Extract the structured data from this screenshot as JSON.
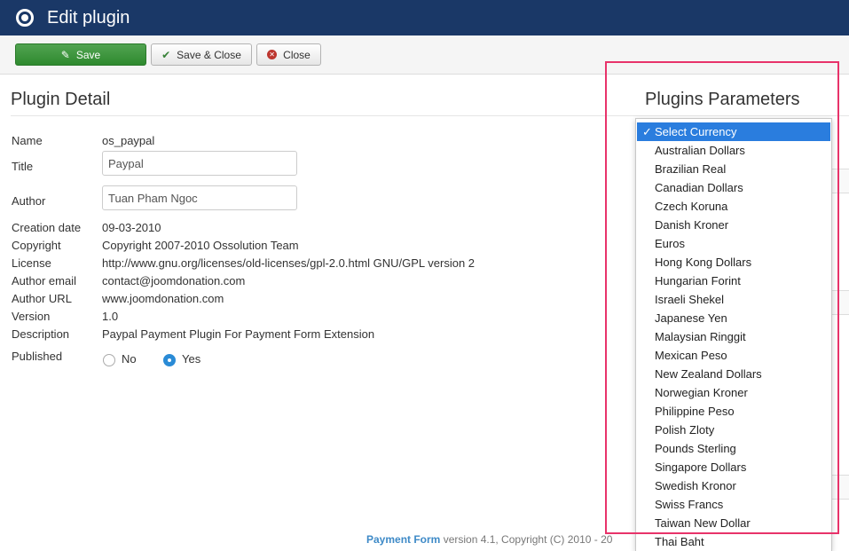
{
  "header": {
    "title": "Edit plugin",
    "icon": "joomla-circle-icon"
  },
  "toolbar": {
    "save_label": "Save",
    "save_close_label": "Save & Close",
    "close_label": "Close"
  },
  "detail": {
    "title": "Plugin Detail",
    "name_label": "Name",
    "name_value": "os_paypal",
    "title_label": "Title",
    "title_value": "Paypal",
    "author_label": "Author",
    "author_value": "Tuan Pham Ngoc",
    "creation_label": "Creation date",
    "creation_value": "09-03-2010",
    "copyright_label": "Copyright",
    "copyright_value": "Copyright 2007-2010 Ossolution Team",
    "license_label": "License",
    "license_value": "http://www.gnu.org/licenses/old-licenses/gpl-2.0.html GNU/GPL version 2",
    "email_label": "Author email",
    "email_value": "contact@joomdonation.com",
    "url_label": "Author URL",
    "url_value": "www.joomdonation.com",
    "version_label": "Version",
    "version_value": "1.0",
    "description_label": "Description",
    "description_value": "Paypal Payment Plugin For Payment Form Extension",
    "published_label": "Published",
    "published_no": "No",
    "published_yes": "Yes",
    "published_selected": "Yes"
  },
  "params": {
    "title": "Plugins Parameters",
    "currency_options": [
      "Select Currency",
      "Australian Dollars",
      "Brazilian Real",
      "Canadian Dollars",
      "Czech Koruna",
      "Danish Kroner",
      "Euros",
      "Hong Kong Dollars",
      "Hungarian Forint",
      "Israeli Shekel",
      "Japanese Yen",
      "Malaysian Ringgit",
      "Mexican Peso",
      "New Zealand Dollars",
      "Norwegian Kroner",
      "Philippine Peso",
      "Polish Zloty",
      "Pounds Sterling",
      "Singapore Dollars",
      "Swedish Kronor",
      "Swiss Francs",
      "Taiwan New Dollar",
      "Thai Baht"
    ],
    "currency_selected": "Select Currency",
    "check_glyph": "✓"
  },
  "footer": {
    "brand": "Payment Form",
    "text": " version 4.1, Copyright (C) 2010 - 20"
  },
  "colors": {
    "header_bg": "#1a3867",
    "save_green": "#3e9b3e",
    "highlight": "#e8336a",
    "select_blue": "#2a7dde"
  }
}
